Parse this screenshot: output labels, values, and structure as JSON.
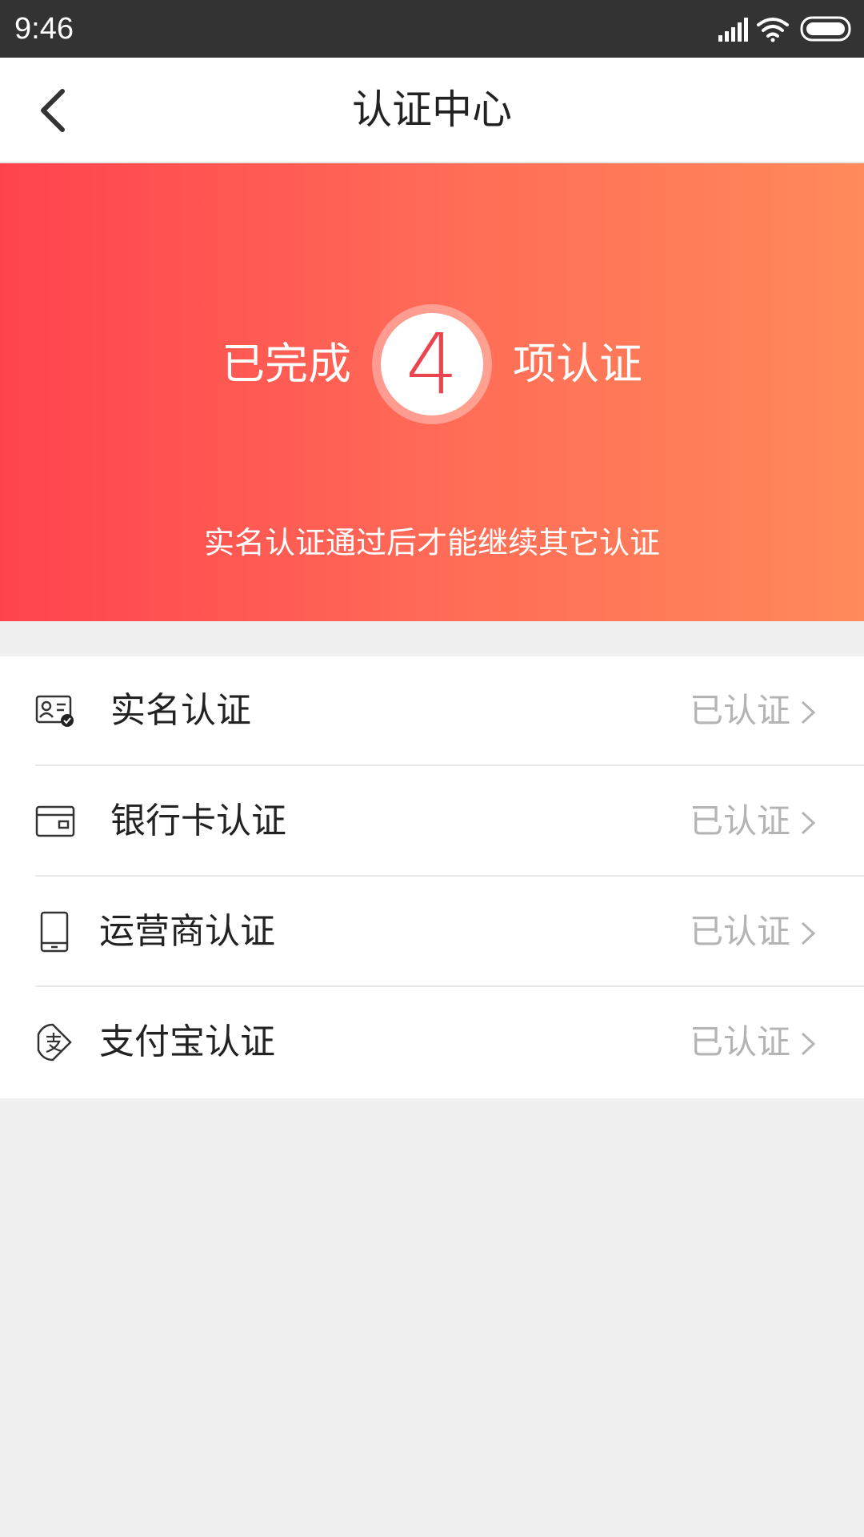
{
  "status_bar": {
    "time": "9:46",
    "icons": [
      "signal-icon",
      "wifi-icon",
      "battery-icon"
    ]
  },
  "nav": {
    "back_icon": "chevron-left-icon",
    "title": "认证中心"
  },
  "hero": {
    "prefix": "已完成",
    "count": "4",
    "suffix": "项认证",
    "hint": "实名认证通过后才能继续其它认证"
  },
  "auth_items": [
    {
      "icon": "id-card-icon",
      "label": "实名认证",
      "status": "已认证"
    },
    {
      "icon": "bank-card-icon",
      "label": "银行卡认证",
      "status": "已认证"
    },
    {
      "icon": "phone-icon",
      "label": "运营商认证",
      "status": "已认证"
    },
    {
      "icon": "alipay-icon",
      "label": "支付宝认证",
      "status": "已认证"
    }
  ],
  "colors": {
    "status_bar": "#333333",
    "hero_gradient_start": "#ff434e",
    "hero_gradient_end": "#ff8a5a",
    "count_text": "#e8454f",
    "status_text": "#b4b4b4",
    "page_background": "#f0f0f0"
  }
}
